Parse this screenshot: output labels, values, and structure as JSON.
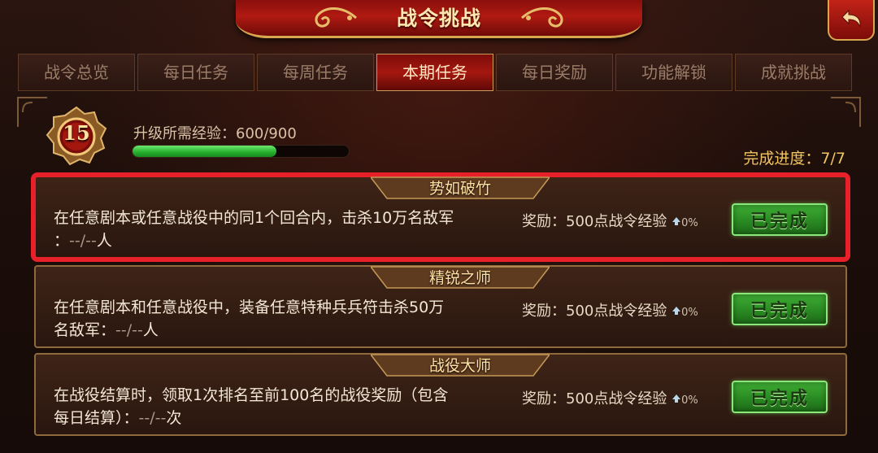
{
  "window": {
    "title": "战令挑战"
  },
  "tabs": [
    {
      "label": "战令总览",
      "active": false
    },
    {
      "label": "每日任务",
      "active": false
    },
    {
      "label": "每周任务",
      "active": false
    },
    {
      "label": "本期任务",
      "active": true
    },
    {
      "label": "每日奖励",
      "active": false
    },
    {
      "label": "功能解锁",
      "active": false
    },
    {
      "label": "成就挑战",
      "active": false
    }
  ],
  "info": {
    "level": "15",
    "exp_label": "升级所需经验：600/900",
    "exp_current": 600,
    "exp_max": 900,
    "progress_text": "完成进度：7/7"
  },
  "tasks": [
    {
      "title": "势如破竹",
      "desc_line1": "在任意剧本或任意战役中的同1个回合内，击杀10万名敌军",
      "desc_line2_prefix": "：",
      "progress": "--/--",
      "unit": "人",
      "reward": "奖励：500点战令经验",
      "bonus": "0%",
      "status": "已完成",
      "selected": true
    },
    {
      "title": "精锐之师",
      "desc_line1": "在任意剧本和任意战役中，装备任意特种兵兵符击杀50万",
      "desc_line2_prefix": "名敌军：",
      "progress": "--/--",
      "unit": "人",
      "reward": "奖励：500点战令经验",
      "bonus": "0%",
      "status": "已完成",
      "selected": false
    },
    {
      "title": "战役大师",
      "desc_line1": "在战役结算时，领取1次排名至前100名的战役奖励（包含",
      "desc_line2_prefix": "每日结算）：",
      "progress": "--/--",
      "unit": "次",
      "reward": "奖励：500点战令经验",
      "bonus": "0%",
      "status": "已完成",
      "selected": false
    }
  ],
  "colors": {
    "accent_red": "#b01a12",
    "gold": "#d9a650",
    "done_green": "#3fae34",
    "selection_red": "#e8202a"
  },
  "icons": {
    "back": "back-arrow-icon",
    "level": "level-badge-icon",
    "bonus": "arrow-up-icon"
  }
}
